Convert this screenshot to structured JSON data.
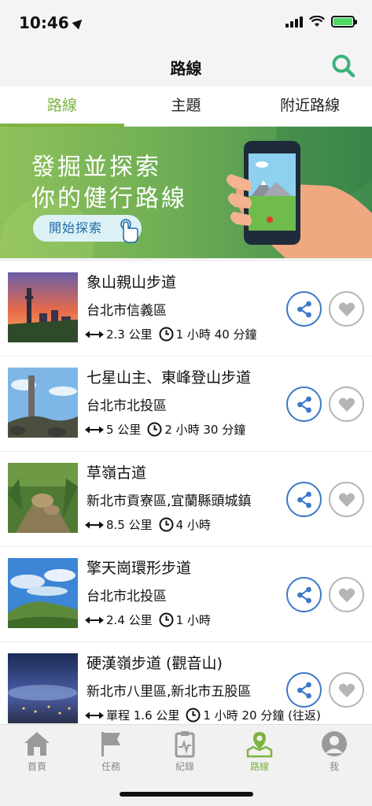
{
  "status": {
    "time": "10:46"
  },
  "nav": {
    "title": "路線"
  },
  "tabs": [
    {
      "label": "路線"
    },
    {
      "label": "主題"
    },
    {
      "label": "附近路線"
    }
  ],
  "banner": {
    "line1": "發掘並探索",
    "line2": "你的健行路線",
    "cta": "開始探索"
  },
  "trails": [
    {
      "name": "象山親山步道",
      "location": "台北市信義區",
      "distance": "2.3 公里",
      "duration": "1 小時 40 分鐘"
    },
    {
      "name": "七星山主、東峰登山步道",
      "location": "台北市北投區",
      "distance": "5 公里",
      "duration": "2 小時 30 分鐘"
    },
    {
      "name": "草嶺古道",
      "location": "新北市貢寮區,宜蘭縣頭城鎮",
      "distance": "8.5 公里",
      "duration": "4 小時"
    },
    {
      "name": "擎天崗環形步道",
      "location": "台北市北投區",
      "distance": "2.4 公里",
      "duration": "1 小時"
    },
    {
      "name": "硬漢嶺步道 (觀音山)",
      "location": "新北市八里區,新北市五股區",
      "distance": "單程 1.6 公里",
      "duration": "1 小時 20 分鐘 (往返)"
    }
  ],
  "tabbar": [
    {
      "label": "首頁",
      "icon": "home-icon"
    },
    {
      "label": "任務",
      "icon": "flag-icon"
    },
    {
      "label": "紀錄",
      "icon": "clipboard-icon"
    },
    {
      "label": "路線",
      "icon": "map-pin-icon"
    },
    {
      "label": "我",
      "icon": "user-icon"
    }
  ],
  "colors": {
    "accent": "#7cb342",
    "share": "#3c79c7",
    "fav": "#b5b5b5",
    "search": "#3ab37a"
  }
}
